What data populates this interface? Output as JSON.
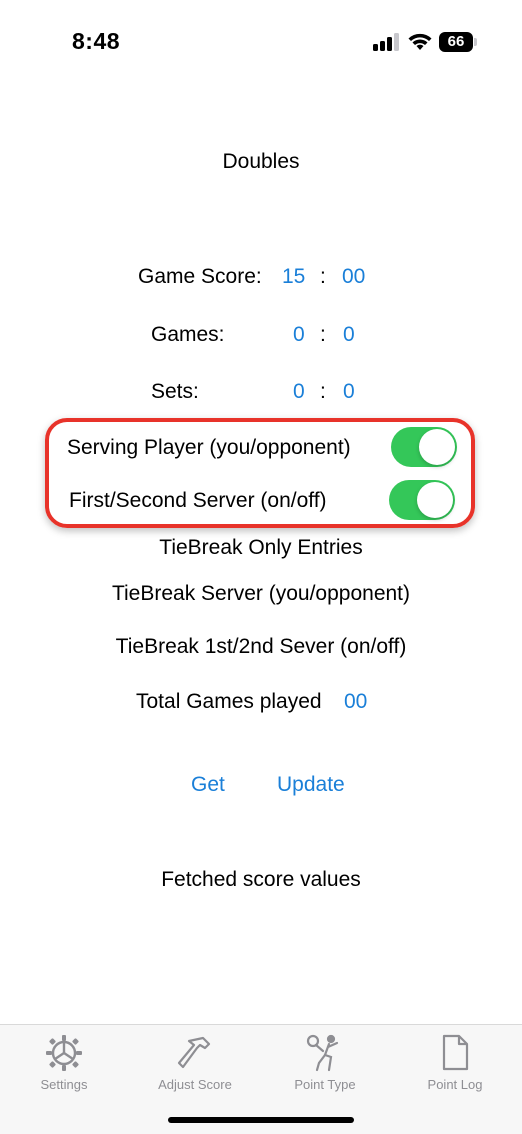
{
  "status_bar": {
    "time": "8:48",
    "battery": "66"
  },
  "title": "Doubles",
  "scores": {
    "game_score_label": "Game Score:",
    "game_score_left": "15",
    "game_score_right": "00",
    "games_label": "Games:",
    "games_left": "0",
    "games_right": "0",
    "sets_label": "Sets:",
    "sets_left": "0",
    "sets_right": "0",
    "separator": ":"
  },
  "toggles": {
    "serving_player_label": "Serving Player (you/opponent)",
    "serving_player_on": true,
    "first_second_label": "First/Second Server (on/off)",
    "first_second_on": true
  },
  "tiebreak": {
    "heading": "TieBreak Only Entries",
    "server_label": "TieBreak Server (you/opponent)",
    "sever_label": "TieBreak 1st/2nd Sever (on/off)"
  },
  "total_games": {
    "label": "Total Games played",
    "value": "00"
  },
  "actions": {
    "get_label": "Get",
    "update_label": "Update"
  },
  "fetched_text": "Fetched score values",
  "tabbar": {
    "items": [
      {
        "label": "Settings",
        "icon": "settings-icon"
      },
      {
        "label": "Adjust Score",
        "icon": "hammer-icon"
      },
      {
        "label": "Point Type",
        "icon": "tennis-player-icon"
      },
      {
        "label": "Point Log",
        "icon": "document-icon"
      }
    ]
  },
  "colors": {
    "accent": "#1a7fd8",
    "toggle_on": "#34c759",
    "highlight": "#e8332a"
  }
}
